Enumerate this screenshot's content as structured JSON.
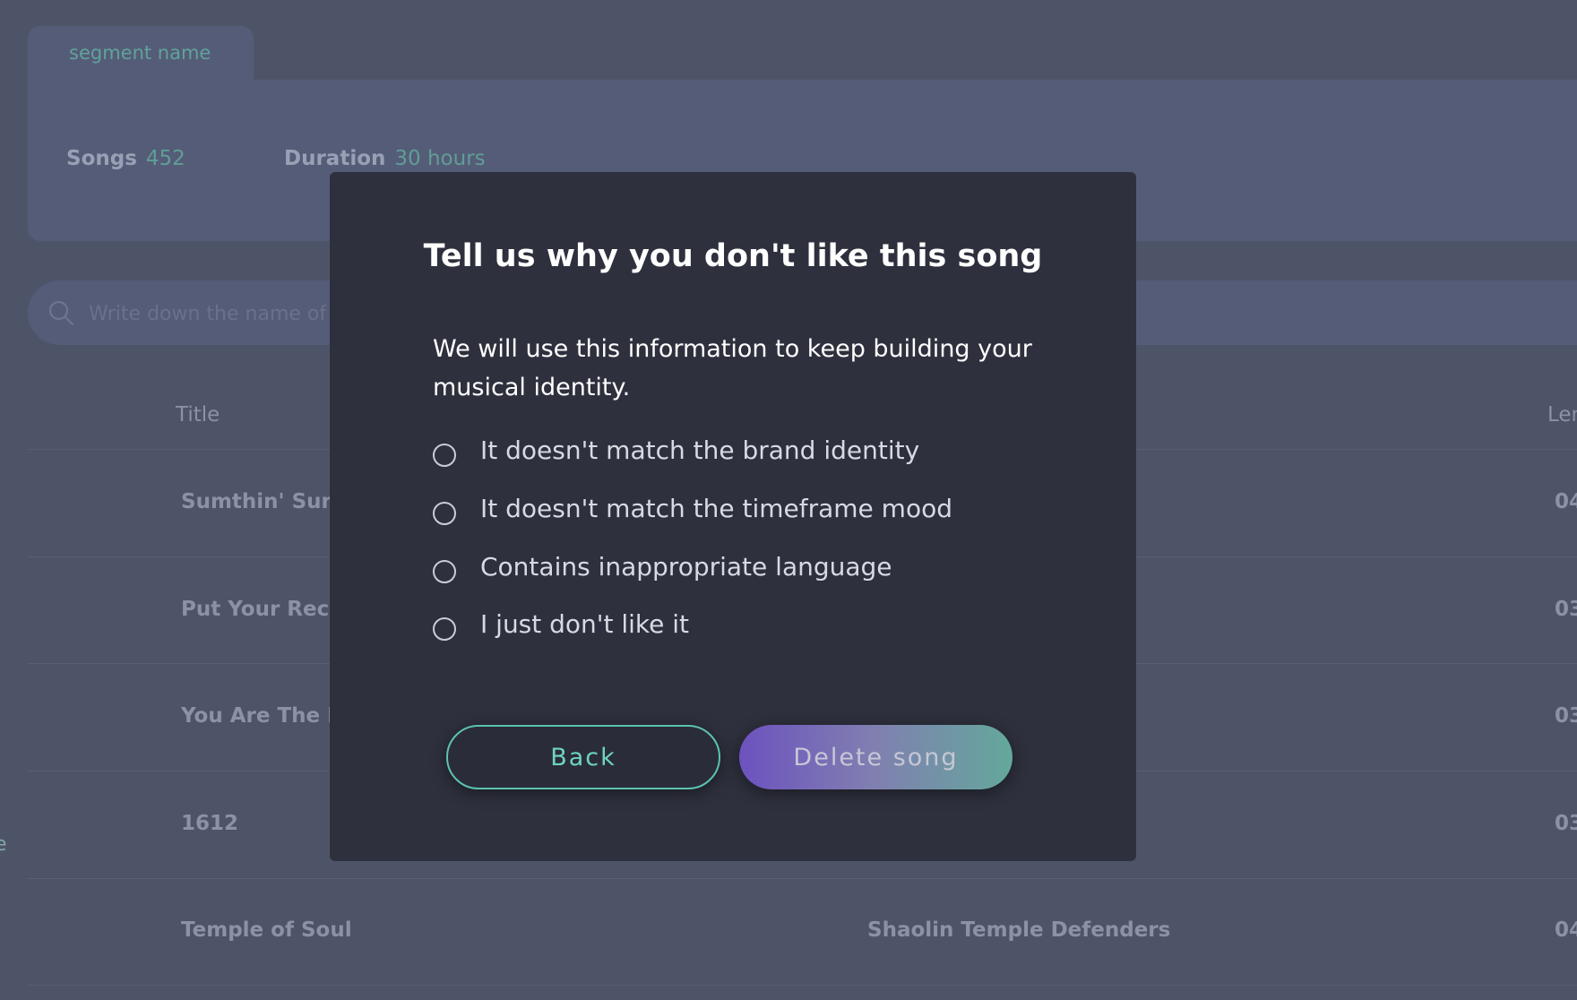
{
  "segment": {
    "tab_label": "segment name",
    "songs_label": "Songs",
    "songs_value": "452",
    "duration_label": "Duration",
    "duration_value": "30 hours"
  },
  "search": {
    "placeholder": "Write down the name of t"
  },
  "table": {
    "col_title": "Title",
    "col_length": "Len",
    "rows": [
      {
        "title": "Sumthin' Sumt",
        "artist": "",
        "length": "04"
      },
      {
        "title": "Put Your Reco",
        "artist": "",
        "length": "03"
      },
      {
        "title": "You Are The Be",
        "artist": "",
        "length": "03"
      },
      {
        "title": "1612",
        "artist": "",
        "length": "03"
      },
      {
        "title": "Temple of Soul",
        "artist": "Shaolin Temple Defenders",
        "length": "04"
      }
    ]
  },
  "sidebar_fragment": "e",
  "modal": {
    "title": "Tell us why you don't like this song",
    "description": "We will use this information to keep building your musical identity.",
    "options": [
      "It doesn't match the brand identity",
      "It doesn't match the timeframe mood",
      "Contains inappropriate language",
      "I just don't like it"
    ],
    "back_label": "Back",
    "delete_label": "Delete song"
  },
  "colors": {
    "background": "#4e5468",
    "modal": "#2e303d",
    "accent_teal": "#5cc3b0",
    "accent_purple": "#6d52bf"
  }
}
